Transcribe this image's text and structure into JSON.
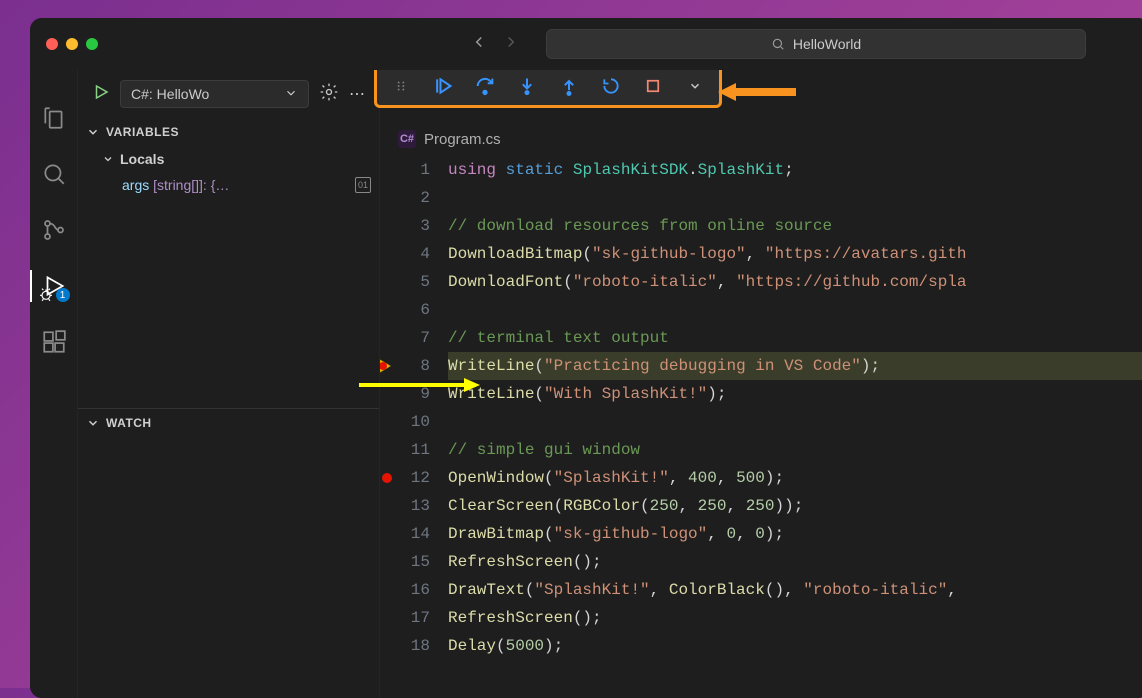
{
  "title_search": {
    "text": "HelloWorld"
  },
  "activity_bar": {
    "debug_badge": "1"
  },
  "panel": {
    "config_label": "C#: HelloWo",
    "variables_hdr": "VARIABLES",
    "locals_hdr": "Locals",
    "var_name": "args",
    "var_type": " [string[]]: {…",
    "watch_hdr": "WATCH"
  },
  "tab": {
    "filename": "Program.cs",
    "lang_icon": "C#"
  },
  "code": {
    "lines": [
      {
        "n": 1,
        "tokens": [
          [
            "kw",
            "using"
          ],
          [
            "pun",
            " "
          ],
          [
            "kw2",
            "static"
          ],
          [
            "pun",
            " "
          ],
          [
            "type",
            "SplashKitSDK"
          ],
          [
            "pun",
            "."
          ],
          [
            "type",
            "SplashKit"
          ],
          [
            "pun",
            ";"
          ]
        ]
      },
      {
        "n": 2,
        "tokens": []
      },
      {
        "n": 3,
        "tokens": [
          [
            "com",
            "// download resources from online source"
          ]
        ]
      },
      {
        "n": 4,
        "tokens": [
          [
            "fn",
            "DownloadBitmap"
          ],
          [
            "pun",
            "("
          ],
          [
            "str",
            "\"sk-github-logo\""
          ],
          [
            "pun",
            ", "
          ],
          [
            "str",
            "\"https://avatars.gith"
          ]
        ]
      },
      {
        "n": 5,
        "tokens": [
          [
            "fn",
            "DownloadFont"
          ],
          [
            "pun",
            "("
          ],
          [
            "str",
            "\"roboto-italic\""
          ],
          [
            "pun",
            ", "
          ],
          [
            "str",
            "\"https://github.com/spla"
          ]
        ]
      },
      {
        "n": 6,
        "tokens": []
      },
      {
        "n": 7,
        "tokens": [
          [
            "com",
            "// terminal text output"
          ]
        ]
      },
      {
        "n": 8,
        "tokens": [
          [
            "fn",
            "WriteLine"
          ],
          [
            "pun",
            "("
          ],
          [
            "str",
            "\"Practicing debugging in VS Code\""
          ],
          [
            "pun",
            ");"
          ]
        ],
        "current": true
      },
      {
        "n": 9,
        "tokens": [
          [
            "fn",
            "WriteLine"
          ],
          [
            "pun",
            "("
          ],
          [
            "str",
            "\"With SplashKit!\""
          ],
          [
            "pun",
            ");"
          ]
        ]
      },
      {
        "n": 10,
        "tokens": []
      },
      {
        "n": 11,
        "tokens": [
          [
            "com",
            "// simple gui window"
          ]
        ]
      },
      {
        "n": 12,
        "tokens": [
          [
            "fn",
            "OpenWindow"
          ],
          [
            "pun",
            "("
          ],
          [
            "str",
            "\"SplashKit!\""
          ],
          [
            "pun",
            ", "
          ],
          [
            "num",
            "400"
          ],
          [
            "pun",
            ", "
          ],
          [
            "num",
            "500"
          ],
          [
            "pun",
            ");"
          ]
        ],
        "breakpoint": true
      },
      {
        "n": 13,
        "tokens": [
          [
            "fn",
            "ClearScreen"
          ],
          [
            "pun",
            "("
          ],
          [
            "fn",
            "RGBColor"
          ],
          [
            "pun",
            "("
          ],
          [
            "num",
            "250"
          ],
          [
            "pun",
            ", "
          ],
          [
            "num",
            "250"
          ],
          [
            "pun",
            ", "
          ],
          [
            "num",
            "250"
          ],
          [
            "pun",
            "));"
          ]
        ]
      },
      {
        "n": 14,
        "tokens": [
          [
            "fn",
            "DrawBitmap"
          ],
          [
            "pun",
            "("
          ],
          [
            "str",
            "\"sk-github-logo\""
          ],
          [
            "pun",
            ", "
          ],
          [
            "num",
            "0"
          ],
          [
            "pun",
            ", "
          ],
          [
            "num",
            "0"
          ],
          [
            "pun",
            ");"
          ]
        ]
      },
      {
        "n": 15,
        "tokens": [
          [
            "fn",
            "RefreshScreen"
          ],
          [
            "pun",
            "();"
          ]
        ]
      },
      {
        "n": 16,
        "tokens": [
          [
            "fn",
            "DrawText"
          ],
          [
            "pun",
            "("
          ],
          [
            "str",
            "\"SplashKit!\""
          ],
          [
            "pun",
            ", "
          ],
          [
            "fn",
            "ColorBlack"
          ],
          [
            "pun",
            "(), "
          ],
          [
            "str",
            "\"roboto-italic\""
          ],
          [
            "pun",
            ", "
          ]
        ]
      },
      {
        "n": 17,
        "tokens": [
          [
            "fn",
            "RefreshScreen"
          ],
          [
            "pun",
            "();"
          ]
        ]
      },
      {
        "n": 18,
        "tokens": [
          [
            "fn",
            "Delay"
          ],
          [
            "pun",
            "("
          ],
          [
            "num",
            "5000"
          ],
          [
            "pun",
            ");"
          ]
        ]
      }
    ]
  }
}
